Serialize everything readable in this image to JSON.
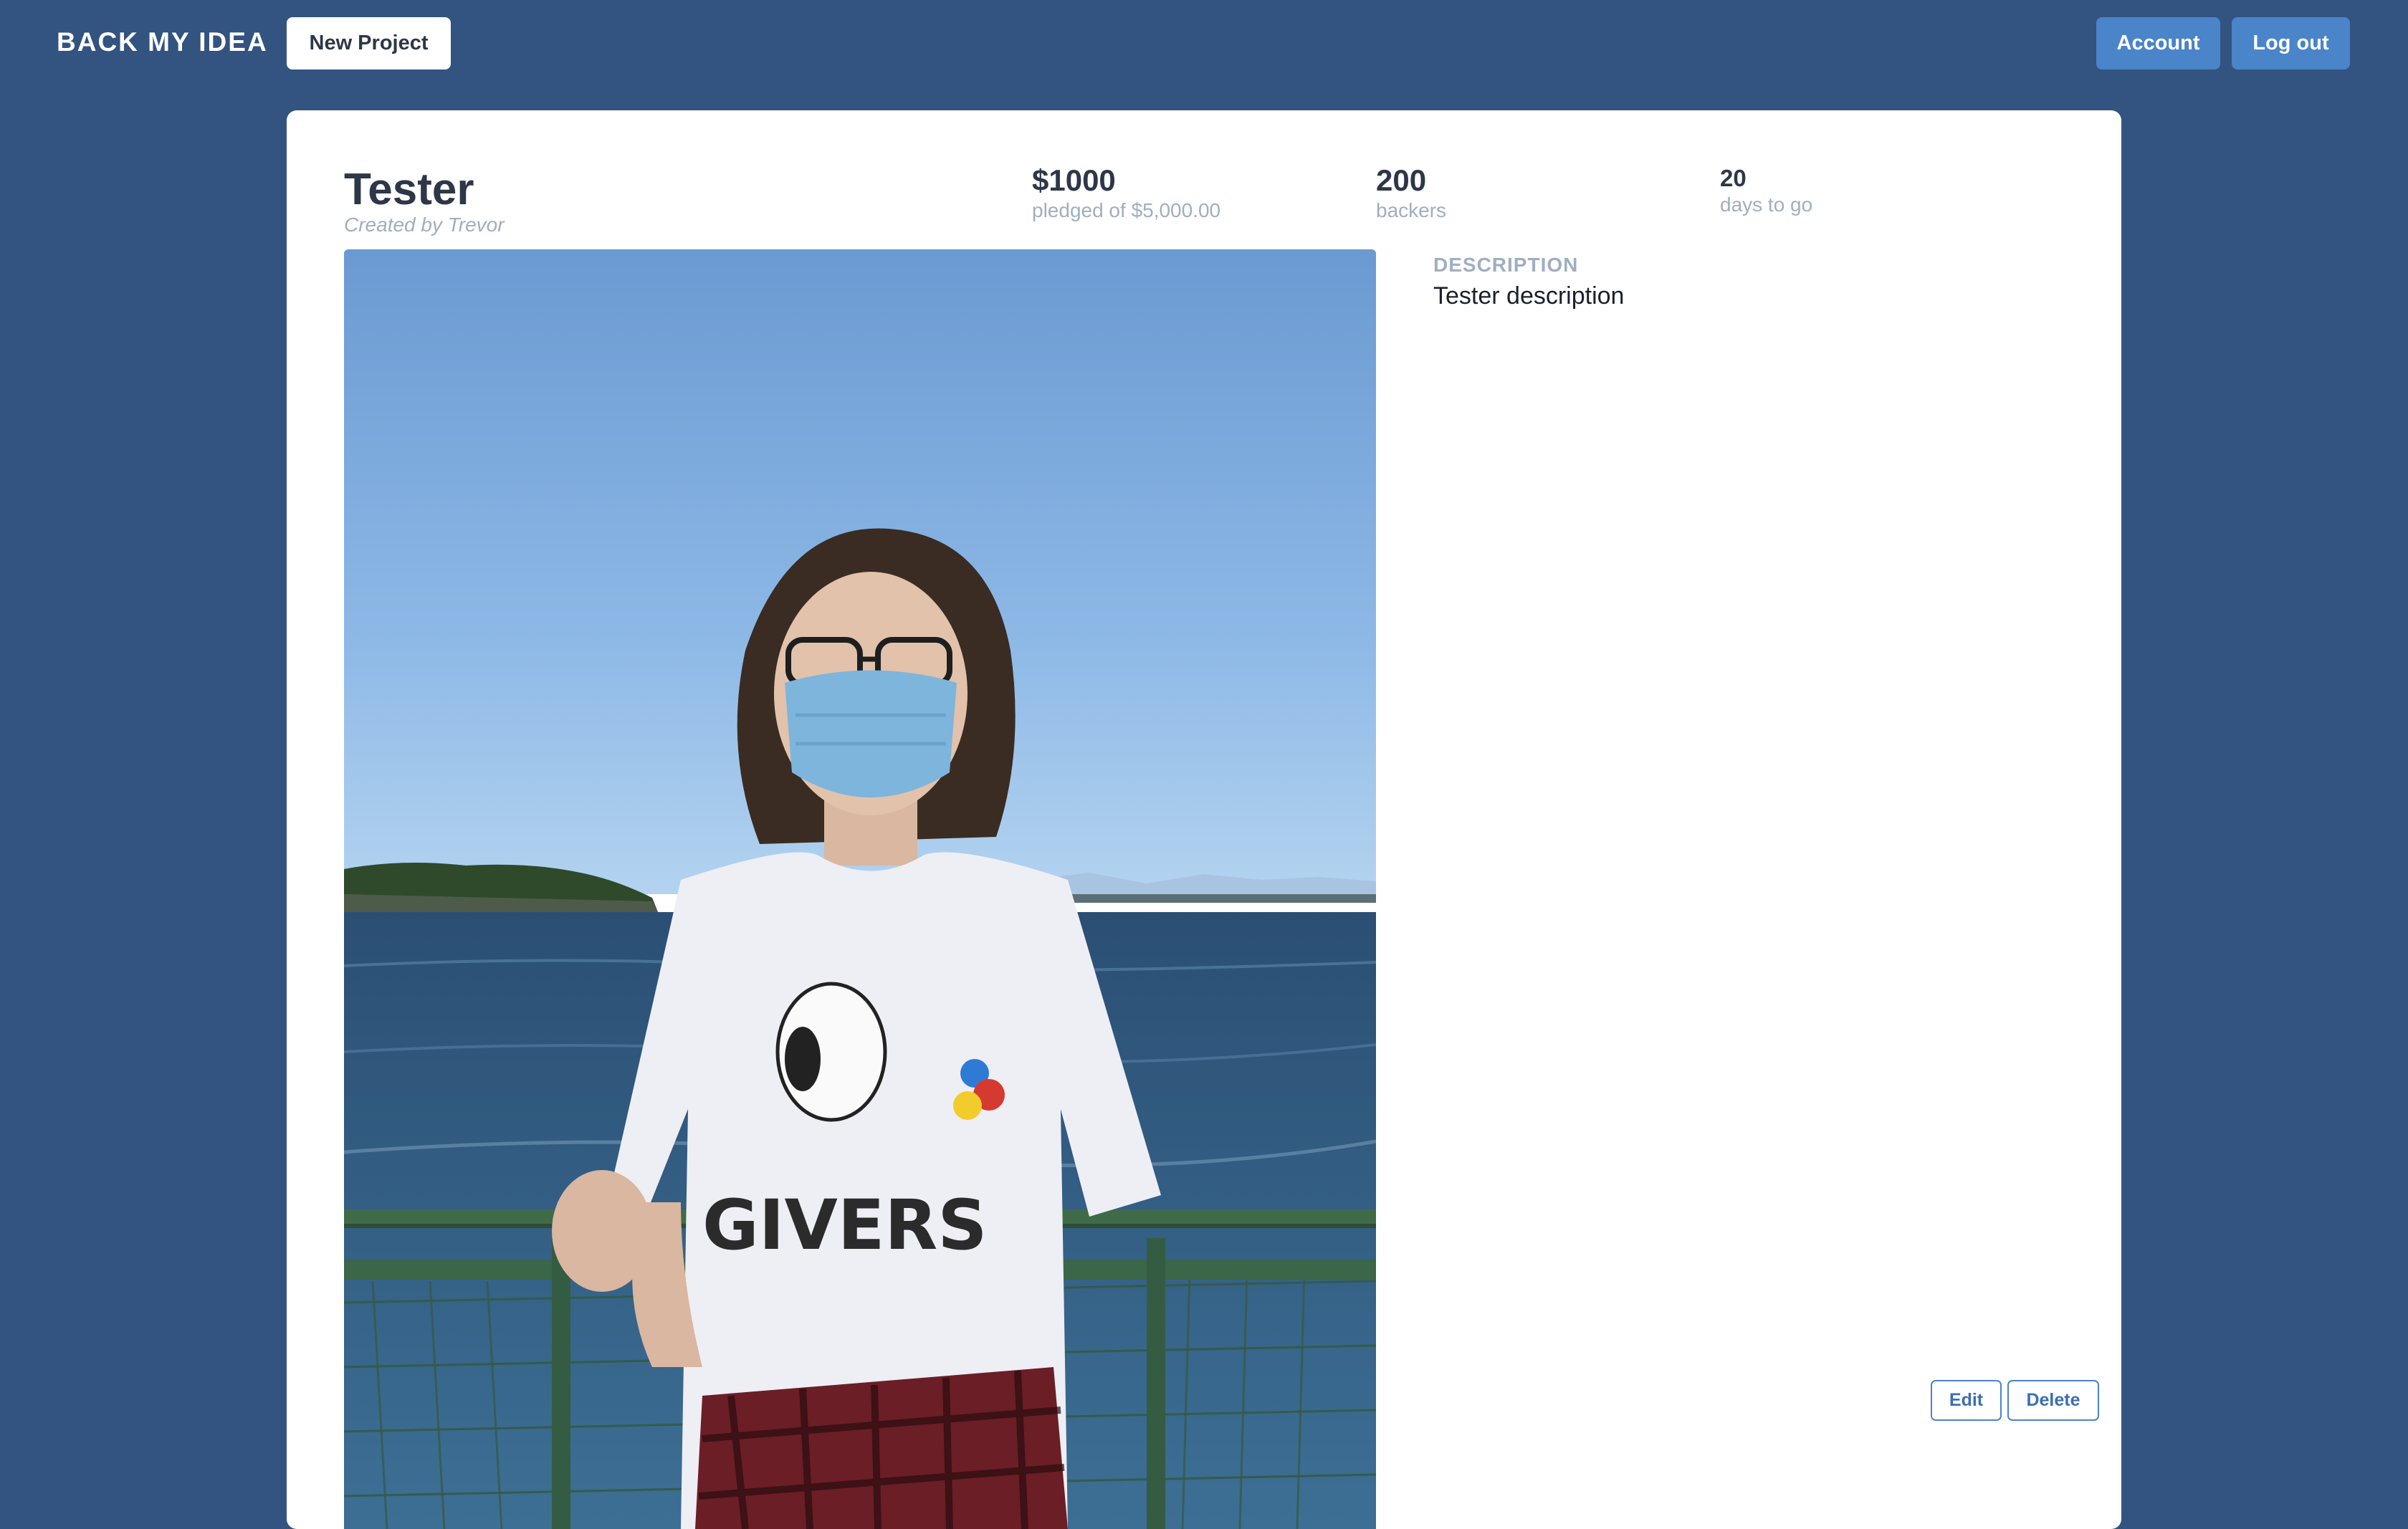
{
  "nav": {
    "brand": "BACK MY IDEA",
    "new_project_label": "New Project",
    "account_label": "Account",
    "logout_label": "Log out"
  },
  "project": {
    "title": "Tester",
    "creator": "Created by Trevor",
    "pledged": "$1000",
    "pledged_label": "pledged of $5,000.00",
    "backers": "200",
    "backers_label": "backers",
    "days": "20",
    "days_label": "days to go",
    "description_heading": "DESCRIPTION",
    "description": "Tester description",
    "edit_label": "Edit",
    "delete_label": "Delete"
  },
  "colors": {
    "page_background": "#335380",
    "accent": "#4a84c9"
  }
}
